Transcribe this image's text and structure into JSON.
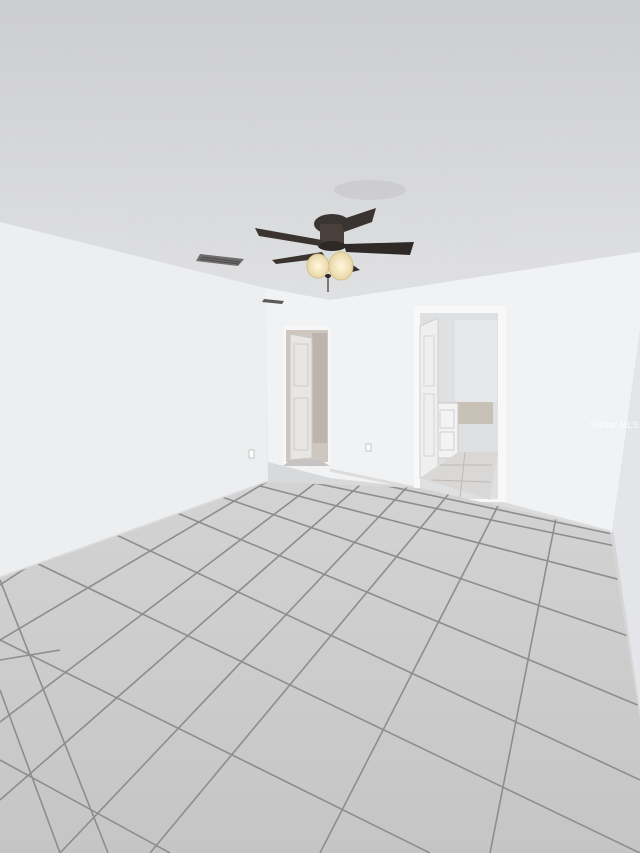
{
  "watermark": {
    "text": "Stellar MLS"
  },
  "colors": {
    "ceiling": "#d9dadc",
    "wall_left": "#eceef0",
    "wall_back": "#f2f3f5",
    "wall_right": "#e4e6e9",
    "floor": "#cbcbcd",
    "grout": "#8e8c8a",
    "fan": "#3a3431",
    "light": "#f6e7c2"
  },
  "objects": {
    "ceiling_fan": "ceiling-fan-icon",
    "air_vent": "air-vent-icon",
    "doorway_closet": "open-door-closet",
    "doorway_bath": "open-door-bathroom"
  }
}
